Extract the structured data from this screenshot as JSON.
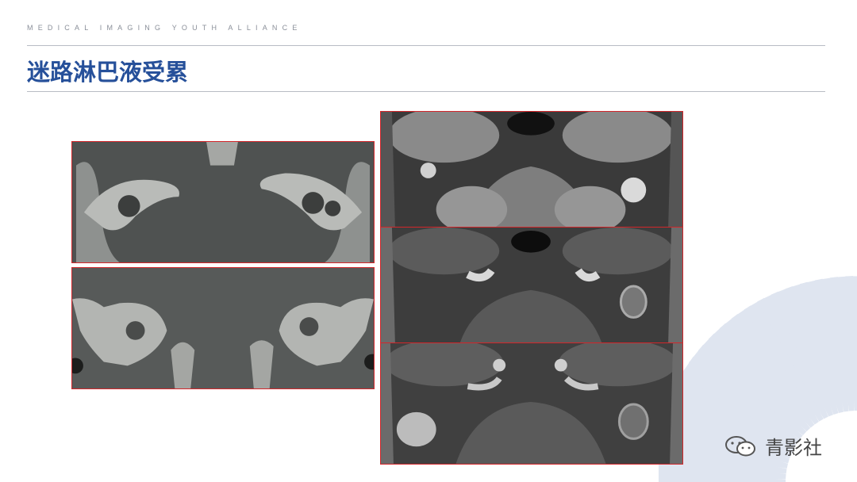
{
  "header": {
    "tagline": "MEDICAL IMAGING YOUTH ALLIANCE",
    "title": "迷路淋巴液受累"
  },
  "figures": {
    "left": [
      {
        "icon": "ct-temporal-bone-axial-image"
      },
      {
        "icon": "ct-temporal-bone-coronal-image"
      }
    ],
    "right": [
      {
        "icon": "mri-t2-axial-image"
      },
      {
        "icon": "mri-t1-axial-image"
      },
      {
        "icon": "mri-t1-contrast-axial-image"
      }
    ],
    "frame_color": "#d3262a"
  },
  "watermark": {
    "label": "青影社",
    "icon": "wechat-icon"
  },
  "colors": {
    "title": "#26509a",
    "rule": "#b8bcc4",
    "decor": "#dfe5f0"
  }
}
